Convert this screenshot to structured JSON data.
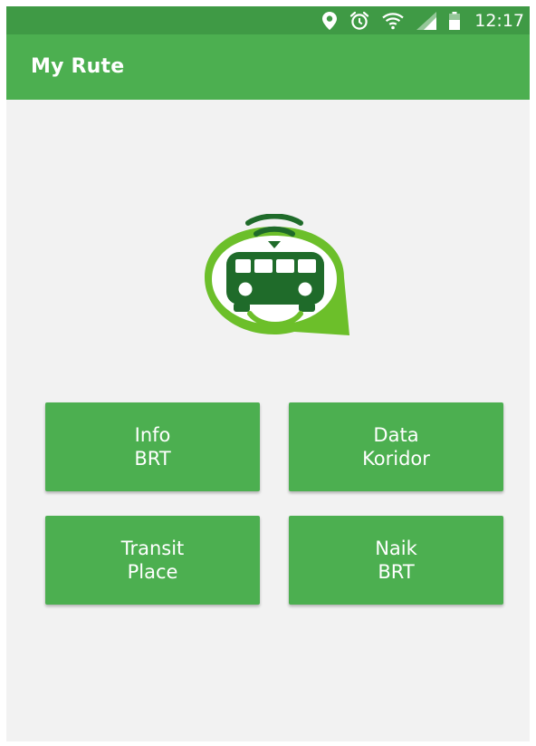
{
  "status_bar": {
    "time": "12:17",
    "icons": [
      "location-pin-icon",
      "alarm-clock-icon",
      "wifi-icon",
      "cell-signal-icon",
      "battery-icon"
    ]
  },
  "app_bar": {
    "title": "My Rute"
  },
  "logo": {
    "icon": "bus-chat-logo-icon"
  },
  "menu": {
    "buttons": [
      {
        "line1": "Info",
        "line2": "BRT"
      },
      {
        "line1": "Data",
        "line2": "Koridor"
      },
      {
        "line1": "Transit",
        "line2": "Place"
      },
      {
        "line1": "Naik",
        "line2": "BRT"
      }
    ]
  },
  "colors": {
    "status_bar": "#3f9a45",
    "app_bar": "#4caf50",
    "button": "#4caf50",
    "background": "#f2f2f2",
    "logo_dark_green": "#1f6b2a",
    "logo_light_green": "#6cbf2a"
  }
}
